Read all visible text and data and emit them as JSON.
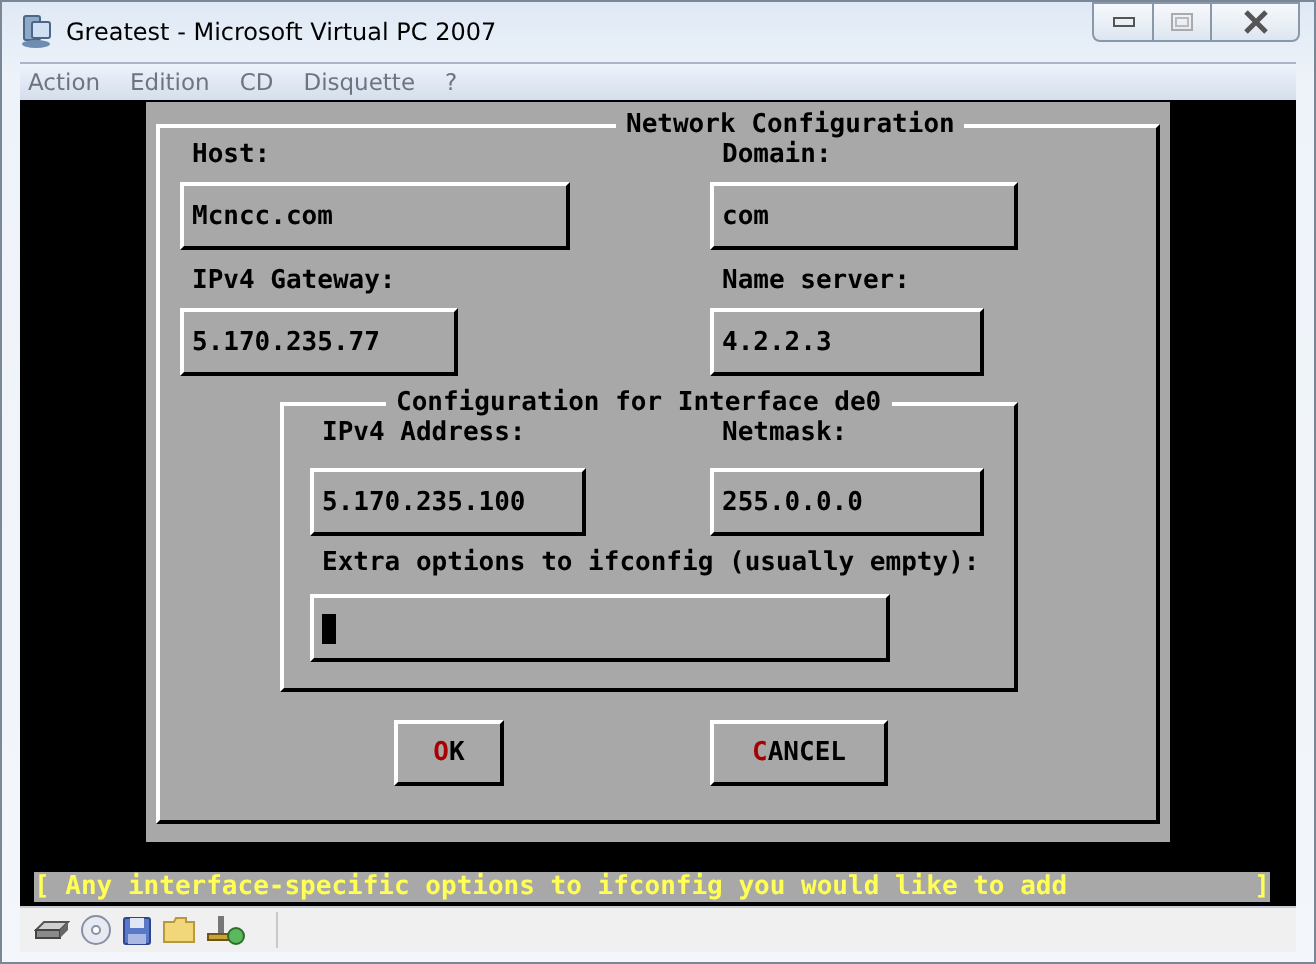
{
  "window": {
    "title": "Greatest - Microsoft Virtual PC 2007"
  },
  "menu": [
    "Action",
    "Edition",
    "CD",
    "Disquette",
    "?"
  ],
  "dialog": {
    "title": "Network Configuration",
    "fields": [
      {
        "label": "Host:",
        "value": "Mcncc.com"
      },
      {
        "label": "Domain:",
        "value": "com"
      },
      {
        "label": "IPv4 Gateway:",
        "value": "5.170.235.77"
      },
      {
        "label": "Name server:",
        "value": "4.2.2.3"
      }
    ],
    "interface_group": {
      "title": "Configuration for Interface de0",
      "fields": [
        {
          "label": "IPv4 Address:",
          "value": "5.170.235.100"
        },
        {
          "label": "Netmask:",
          "value": "255.0.0.0"
        }
      ],
      "extra": {
        "label": "Extra options to ifconfig (usually empty):",
        "focused": true
      }
    },
    "buttons": [
      {
        "hotkey": "O",
        "rest": "K"
      },
      {
        "hotkey": "C",
        "rest": "ANCEL"
      }
    ]
  },
  "status_line": {
    "open": "[",
    "text": "Any interface-specific options to ifconfig you would like to add",
    "close": "]"
  }
}
